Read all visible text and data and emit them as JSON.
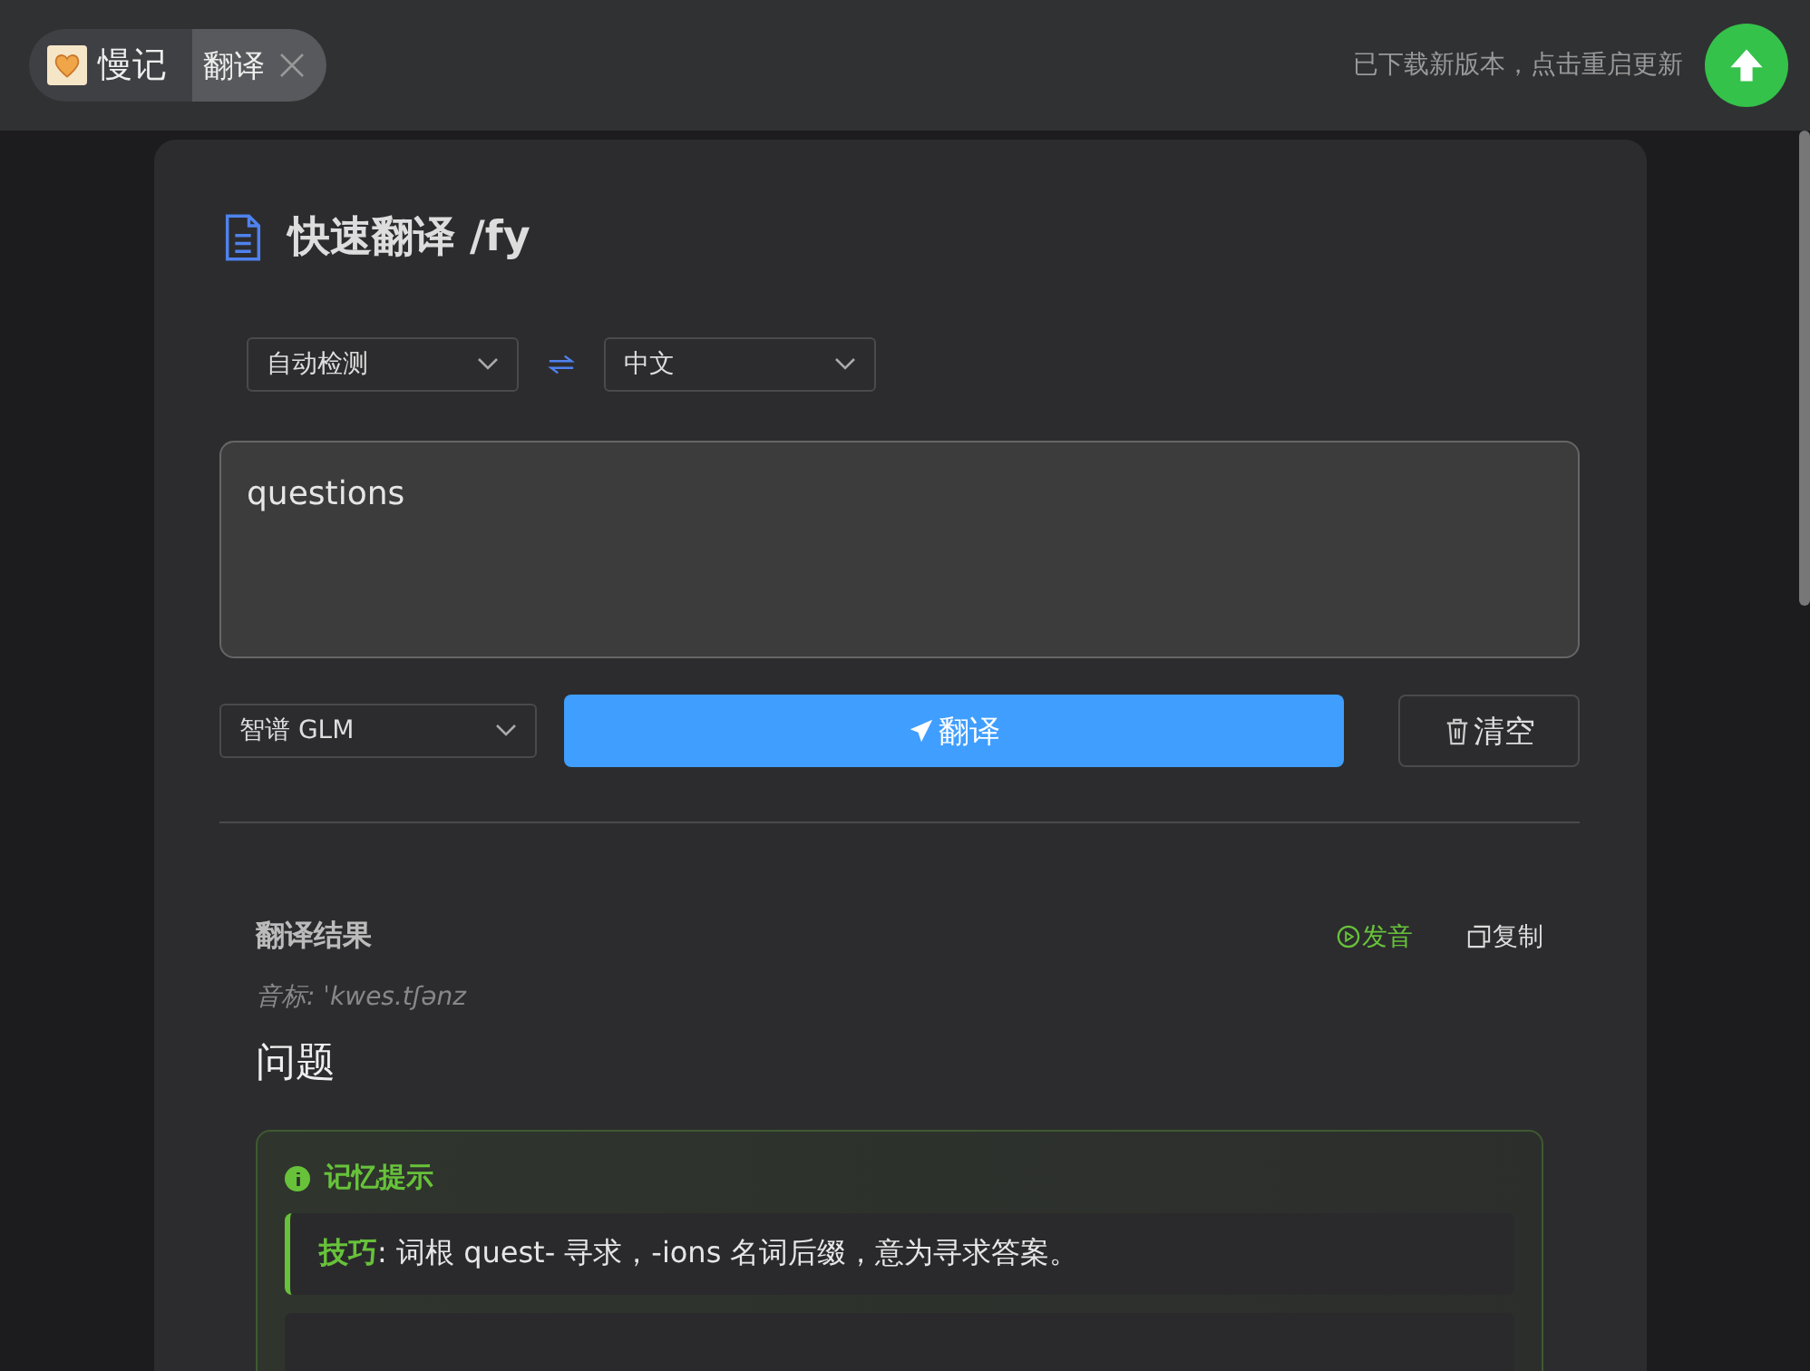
{
  "titlebar": {
    "app_name": "慢记",
    "tabs": [
      {
        "label": "翻译",
        "selected": true
      }
    ],
    "update_notice": "已下载新版本，点击重启更新"
  },
  "panel": {
    "title": "快速翻译 /fy",
    "source_language": "自动检测",
    "target_language": "中文",
    "input_value": "questions",
    "model": "智谱 GLM",
    "translate_button": "翻译",
    "clear_button": "清空"
  },
  "result": {
    "heading": "翻译结果",
    "speak_button": "发音",
    "copy_button": "复制",
    "phonetic": "音标: ˈkwes.tʃənz",
    "translation": "问题",
    "memory_tip": {
      "title": "记忆提示",
      "tip": "**技巧**: 词根 quest- 寻求，-ions 名词后缀，意为寻求答案。"
    }
  }
}
